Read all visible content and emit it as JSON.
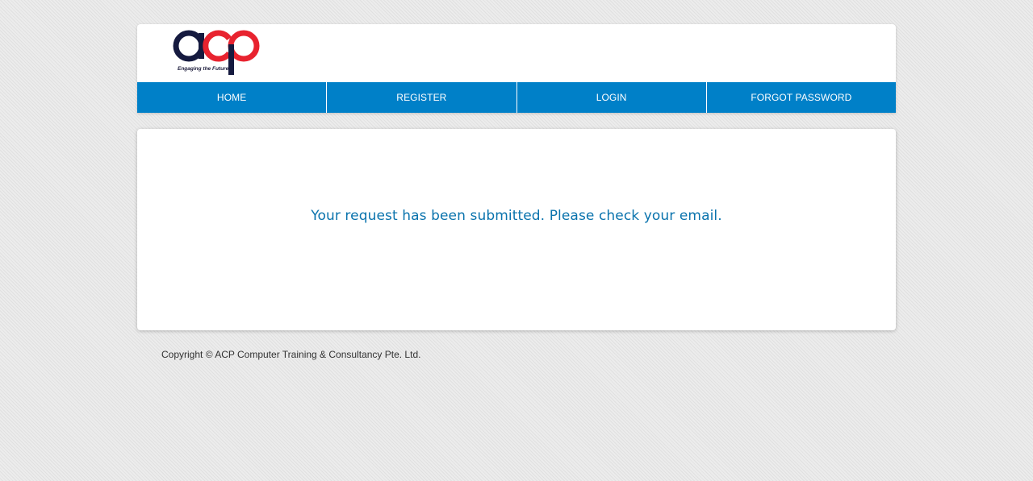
{
  "brand": {
    "logo_text": "acp",
    "tagline": "Engaging the Future",
    "colors": {
      "navy": "#151a3f",
      "red": "#e8232f"
    }
  },
  "nav": {
    "items": [
      {
        "label": "HOME"
      },
      {
        "label": "REGISTER"
      },
      {
        "label": "LOGIN"
      },
      {
        "label": "FORGOT PASSWORD"
      }
    ],
    "background": "#0080c8"
  },
  "main": {
    "message": "Your request has been submitted. Please check your email.",
    "message_color": "#0a73ad"
  },
  "footer": {
    "copyright": "Copyright © ACP Computer Training & Consultancy Pte. Ltd."
  }
}
